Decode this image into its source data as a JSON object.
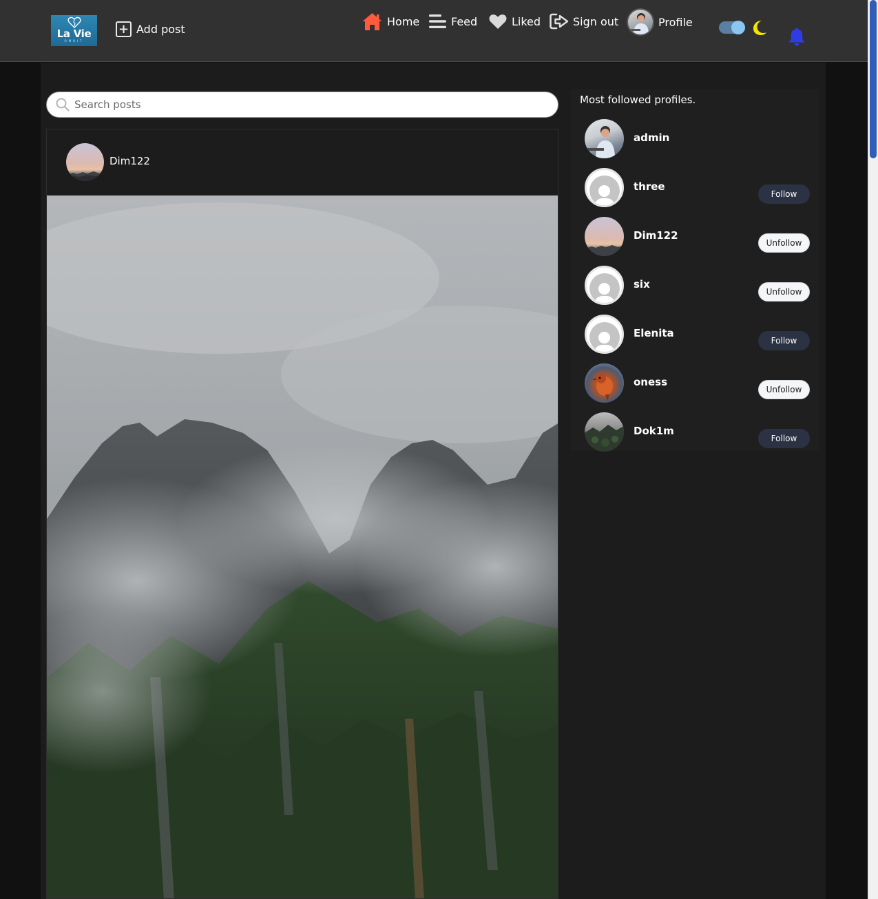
{
  "app": {
    "logo_text": "La Vie",
    "logo_sub": "OMBIT"
  },
  "nav": {
    "add_post": "Add post",
    "home": "Home",
    "feed": "Feed",
    "liked": "Liked",
    "sign_out": "Sign out",
    "profile": "Profile",
    "dark_mode_on": true,
    "accent_home": "#ff5a3c",
    "accent_bell": "#2f3ce6",
    "accent_moon": "#f5e300"
  },
  "search": {
    "placeholder": "Search posts",
    "value": ""
  },
  "post": {
    "author": "Dim122",
    "image_icon": "mountain-photo"
  },
  "sidebar": {
    "title": "Most followed profiles.",
    "profiles": [
      {
        "name": "admin",
        "button": ""
      },
      {
        "name": "three",
        "button": "Follow"
      },
      {
        "name": "Dim122",
        "button": "Unfollow"
      },
      {
        "name": "six",
        "button": "Unfollow"
      },
      {
        "name": "Elenita",
        "button": "Follow"
      },
      {
        "name": "oness",
        "button": "Unfollow"
      },
      {
        "name": "Dok1m",
        "button": "Follow"
      }
    ]
  }
}
